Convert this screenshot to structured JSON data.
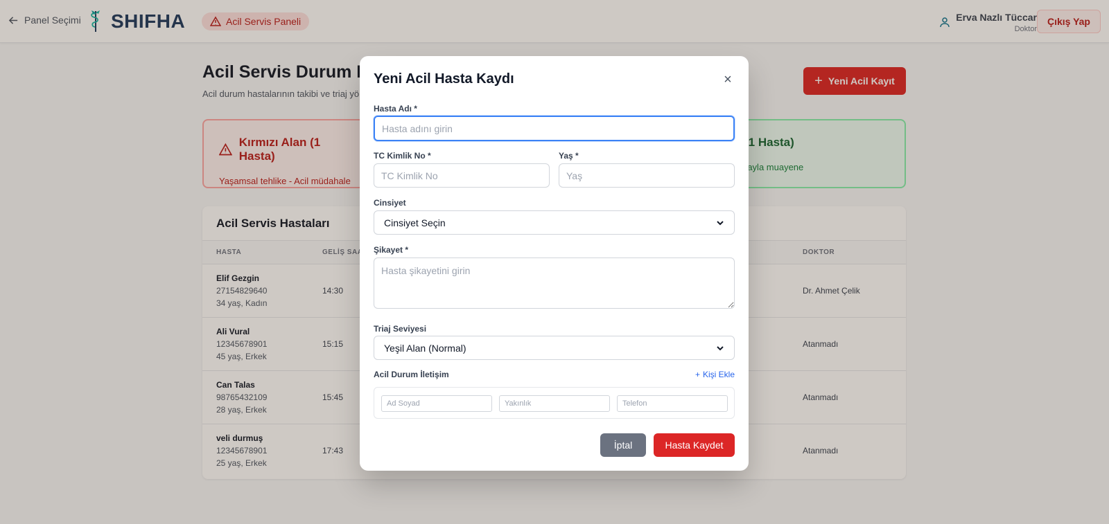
{
  "header": {
    "back_label": "Panel Seçimi",
    "logo_text": "SHIFHA",
    "panel_label": "Acil Servis Paneli",
    "user_name": "Erva Nazlı Tüccar",
    "user_role": "Doktor",
    "logout_label": "Çıkış Yap"
  },
  "page": {
    "title": "Acil Servis Durum P",
    "subtitle": "Acil durum hastalarının takibi ve triaj yö",
    "new_button": "Yeni Acil Kayıt"
  },
  "zones": {
    "red": {
      "title": "Kırmızı Alan (1 Hasta)",
      "desc": "Yaşamsal tehlike - Acil müdahale"
    },
    "green": {
      "title": "(1 Hasta)",
      "desc": "rayla muayene"
    }
  },
  "table": {
    "title": "Acil Servis Hastaları",
    "headers": [
      "HASTA",
      "GELİŞ SAAT",
      "DOKTOR"
    ],
    "rows": [
      {
        "name": "Elif Gezgin",
        "tc": "27154829640",
        "info": "34 yaş, Kadın",
        "time": "14:30",
        "doctor": "Dr. Ahmet Çelik"
      },
      {
        "name": "Ali Vural",
        "tc": "12345678901",
        "info": "45 yaş, Erkek",
        "time": "15:15",
        "doctor": "Atanmadı"
      },
      {
        "name": "Can Talas",
        "tc": "98765432109",
        "info": "28 yaş, Erkek",
        "time": "15:45",
        "doctor": "Atanmadı"
      },
      {
        "name": "veli durmuş",
        "tc": "12345678901",
        "info": "25 yaş, Erkek",
        "time": "17:43",
        "doctor": "Atanmadı"
      }
    ]
  },
  "modal": {
    "title": "Yeni Acil Hasta Kaydı",
    "close": "×",
    "name_label": "Hasta Adı *",
    "name_placeholder": "Hasta adını girin",
    "tc_label": "TC Kimlik No *",
    "tc_placeholder": "TC Kimlik No",
    "age_label": "Yaş *",
    "age_placeholder": "Yaş",
    "gender_label": "Cinsiyet",
    "gender_value": "Cinsiyet Seçin",
    "complaint_label": "Şikayet *",
    "complaint_placeholder": "Hasta şikayetini girin",
    "triage_label": "Triaj Seviyesi",
    "triage_value": "Yeşil Alan (Normal)",
    "contact_label": "Acil Durum İletişim",
    "add_contact": "Kişi Ekle",
    "contact_name_placeholder": "Ad Soyad",
    "contact_relation_placeholder": "Yakınlık",
    "contact_phone_placeholder": "Telefon",
    "cancel": "İptal",
    "save": "Hasta Kaydet"
  },
  "colors": {
    "accent_red": "#dc2626",
    "focus_blue": "#3b82f6",
    "link_blue": "#2563eb",
    "brand_navy": "#1e3a5f"
  }
}
